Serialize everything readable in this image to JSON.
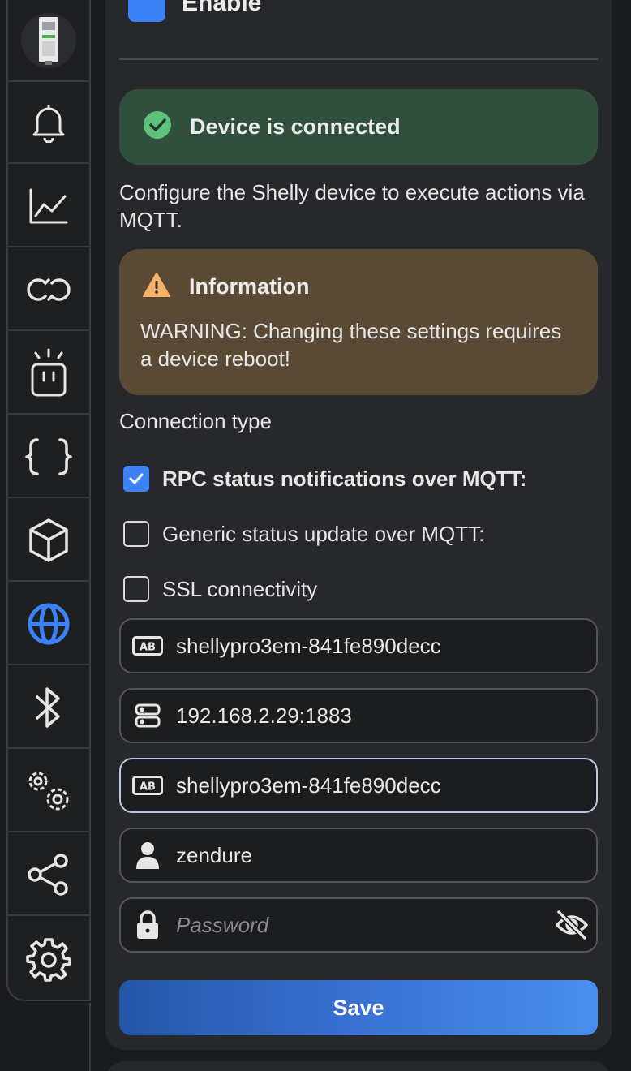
{
  "sidebar": {
    "items": [
      {
        "name": "device-image"
      },
      {
        "icon": "bell-icon"
      },
      {
        "icon": "chart-line-icon"
      },
      {
        "icon": "link-icon"
      },
      {
        "icon": "action-light-icon"
      },
      {
        "icon": "braces-icon"
      },
      {
        "icon": "cube-icon"
      },
      {
        "icon": "globe-icon",
        "active": true
      },
      {
        "icon": "bluetooth-icon"
      },
      {
        "icon": "gears-icon"
      },
      {
        "icon": "share-icon"
      },
      {
        "icon": "settings-icon"
      }
    ],
    "active_color": "#3b82f6"
  },
  "enable": {
    "label": "Enable",
    "checked": true
  },
  "status": {
    "title": "Device is connected",
    "color": "#30503d"
  },
  "description": "Configure the Shelly device to execute actions via MQTT.",
  "info": {
    "title": "Information",
    "body": "WARNING: Changing these settings requires a device reboot!",
    "color": "#5a4a35"
  },
  "connection_type_label": "Connection type",
  "options": [
    {
      "label": "RPC status notifications over MQTT:",
      "checked": true
    },
    {
      "label": "Generic status update over MQTT:",
      "checked": false
    },
    {
      "label": "SSL connectivity",
      "checked": false
    }
  ],
  "fields": {
    "client_id": {
      "value": "shellypro3em-841fe890decc",
      "icon": "ab-icon"
    },
    "server": {
      "value": "192.168.2.29:1883",
      "icon": "server-icon"
    },
    "topic_prefix": {
      "value": "shellypro3em-841fe890decc",
      "icon": "ab-icon"
    },
    "username": {
      "value": "zendure",
      "icon": "user-icon"
    },
    "password": {
      "value": "",
      "placeholder": "Password",
      "icon": "lock-icon"
    }
  },
  "save_label": "Save",
  "accent_color": "#3b82f6"
}
